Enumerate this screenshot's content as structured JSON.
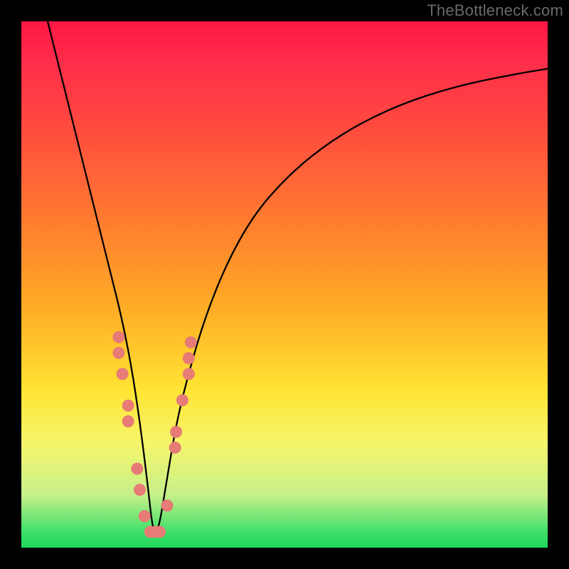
{
  "watermark": "TheBottleneck.com",
  "chart_data": {
    "type": "line",
    "title": "",
    "xlabel": "",
    "ylabel": "",
    "xlim": [
      0,
      100
    ],
    "ylim": [
      0,
      100
    ],
    "grid": false,
    "legend": false,
    "curve": {
      "name": "bottleneck",
      "color": "#000000",
      "x": [
        5,
        7,
        9,
        11,
        13,
        15,
        17,
        19,
        21,
        22.5,
        24,
        25,
        26,
        27.5,
        29.5,
        32,
        35,
        39,
        44,
        50,
        57,
        65,
        74,
        84,
        94,
        100
      ],
      "y": [
        100,
        92,
        84,
        76,
        68,
        60,
        52,
        44,
        34,
        24,
        12,
        3,
        3,
        12,
        24,
        34,
        44,
        54,
        63,
        70,
        76,
        81,
        85,
        88,
        90,
        91
      ]
    },
    "markers": {
      "name": "highlighted-points",
      "color": "#e77b76",
      "points": [
        {
          "x": 18.5,
          "y": 40
        },
        {
          "x": 18.5,
          "y": 37
        },
        {
          "x": 19.2,
          "y": 33
        },
        {
          "x": 20.3,
          "y": 27
        },
        {
          "x": 20.3,
          "y": 24
        },
        {
          "x": 22.0,
          "y": 15
        },
        {
          "x": 22.5,
          "y": 11
        },
        {
          "x": 23.4,
          "y": 6
        },
        {
          "x": 24.5,
          "y": 3
        },
        {
          "x": 25.4,
          "y": 3
        },
        {
          "x": 26.3,
          "y": 3
        },
        {
          "x": 27.7,
          "y": 8
        },
        {
          "x": 29.2,
          "y": 19
        },
        {
          "x": 29.4,
          "y": 22
        },
        {
          "x": 30.6,
          "y": 28
        },
        {
          "x": 31.8,
          "y": 33
        },
        {
          "x": 31.8,
          "y": 36
        },
        {
          "x": 32.2,
          "y": 39
        }
      ]
    },
    "gradient_stops": [
      {
        "pos": 0,
        "color": "#ff1744"
      },
      {
        "pos": 38,
        "color": "#ff7c2f"
      },
      {
        "pos": 70,
        "color": "#ffe433"
      },
      {
        "pos": 100,
        "color": "#1fd85b"
      }
    ]
  }
}
